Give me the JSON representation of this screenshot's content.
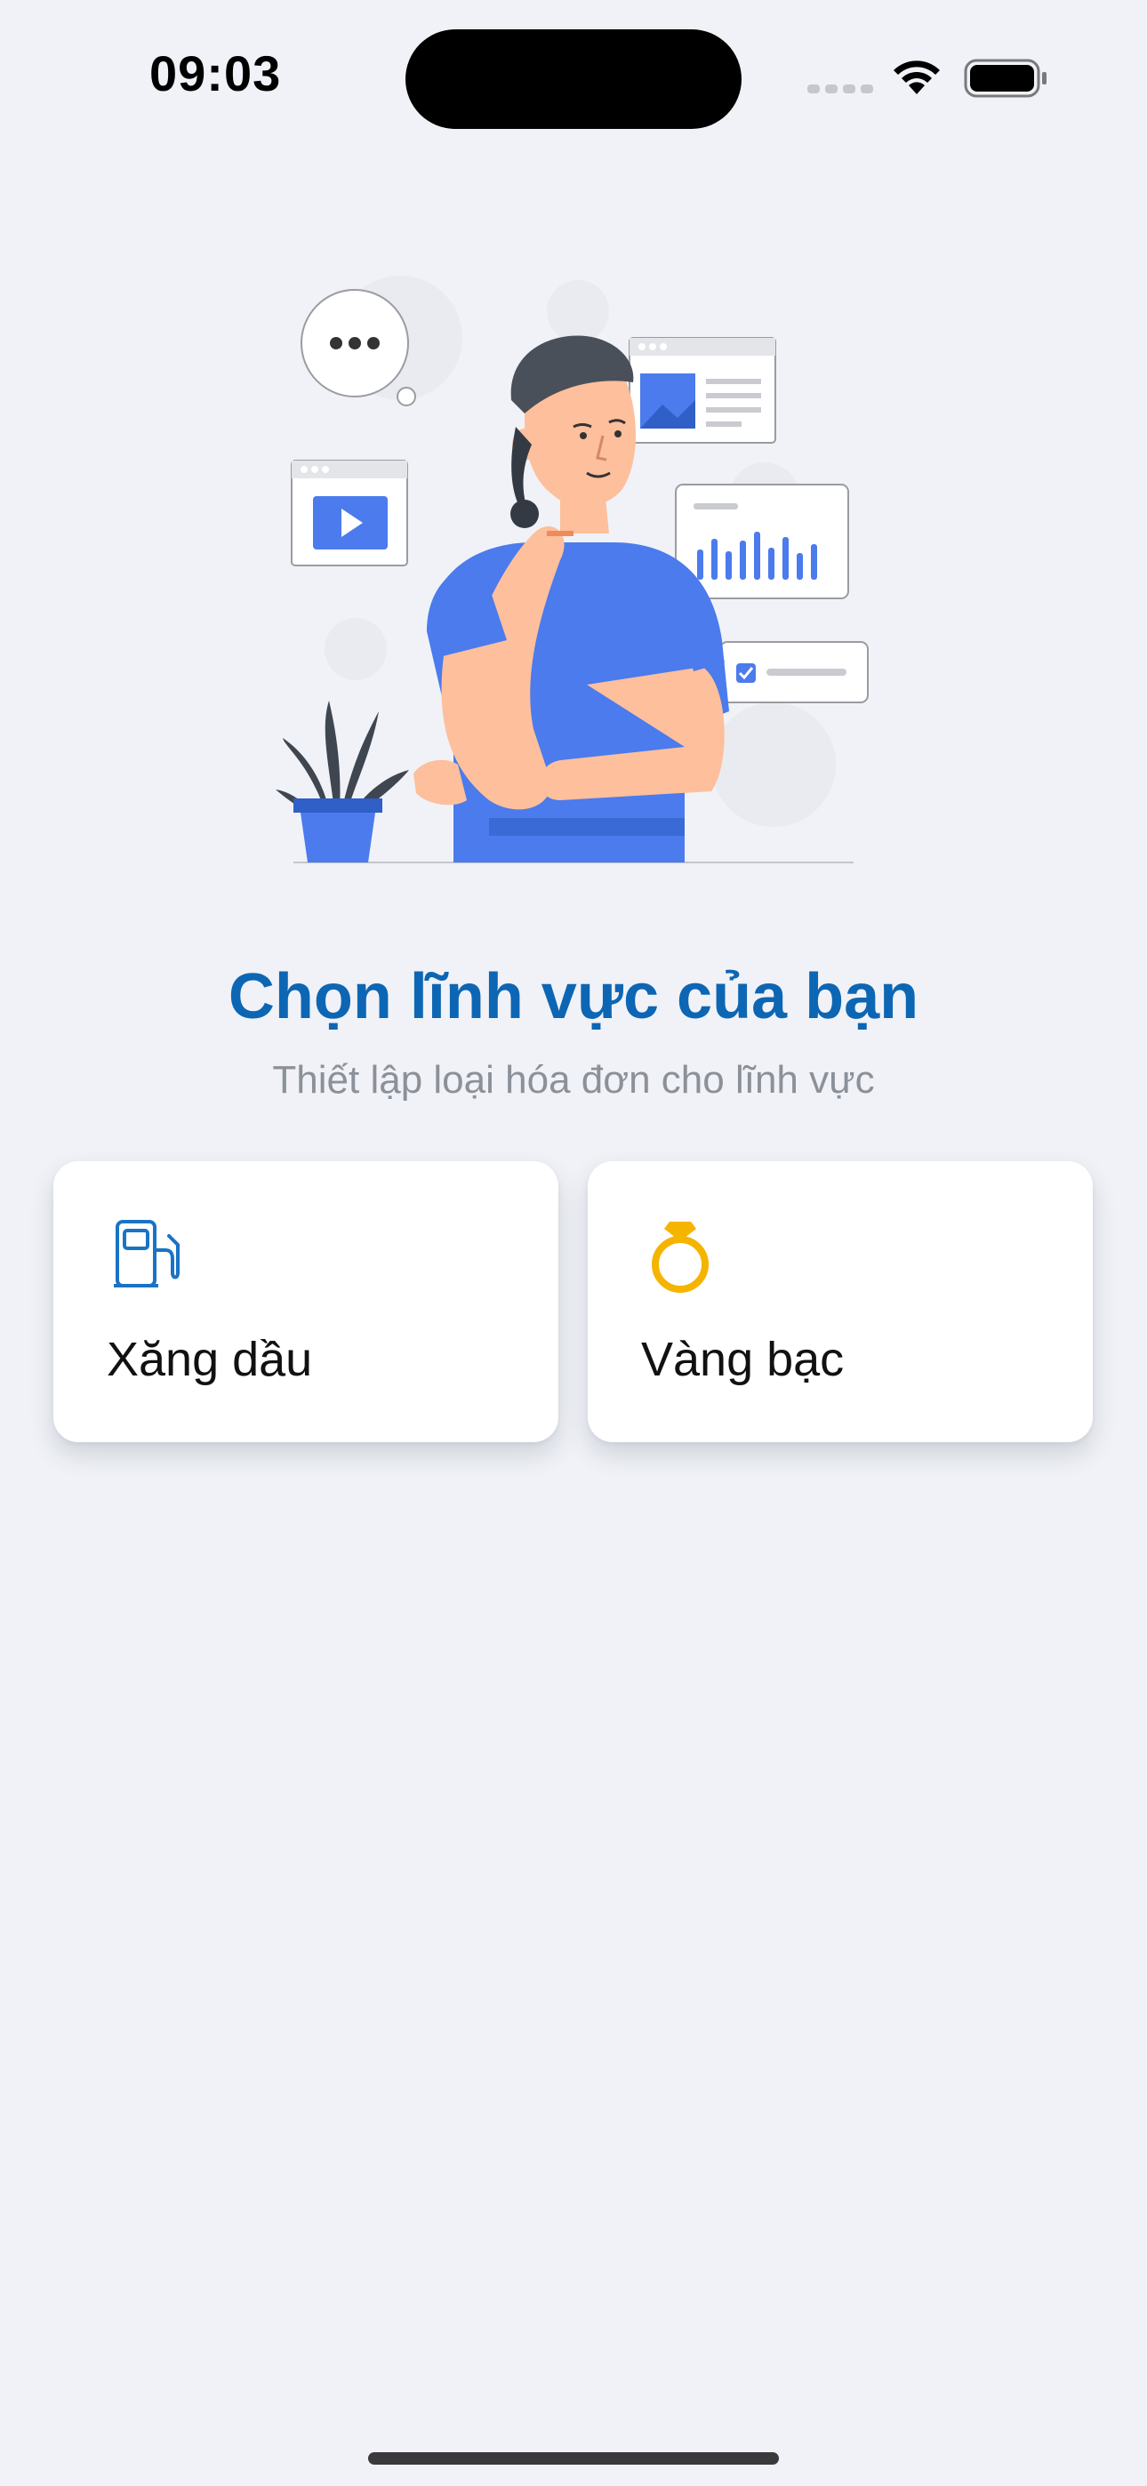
{
  "status_bar": {
    "time": "09:03"
  },
  "illustration": {
    "icon": "thinking-person-illustration"
  },
  "header": {
    "title": "Chọn lĩnh vực của bạn",
    "subtitle": "Thiết lập loại hóa đơn cho lĩnh vực"
  },
  "options": [
    {
      "label": "Xăng dầu",
      "icon": "fuel-pump-icon",
      "color": "#1a73c4"
    },
    {
      "label": "Vàng bạc",
      "icon": "gold-ring-icon",
      "color": "#f5b400"
    }
  ],
  "colors": {
    "background": "#f0f2f7",
    "title": "#0d66b3",
    "subtitle": "#8c9099",
    "illustration_accent": "#4b7bec"
  }
}
